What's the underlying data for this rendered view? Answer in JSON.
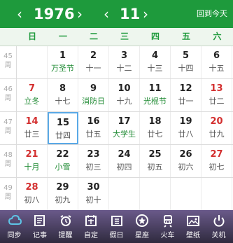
{
  "header": {
    "prev_year": "‹",
    "year": "1976",
    "next_year": "›",
    "prev_month": "‹",
    "month": "11",
    "next_month": "›",
    "today": "回到今天"
  },
  "weekdays": [
    "日",
    "一",
    "二",
    "三",
    "四",
    "五",
    "六"
  ],
  "weeks": [
    {
      "num": "45",
      "label": "周",
      "days": [
        {
          "d": "",
          "l": ""
        },
        {
          "d": "1",
          "l": "万圣节",
          "c": "grn"
        },
        {
          "d": "2",
          "l": "十一"
        },
        {
          "d": "3",
          "l": "十二"
        },
        {
          "d": "4",
          "l": "十三"
        },
        {
          "d": "5",
          "l": "十四"
        },
        {
          "d": "6",
          "l": "十五"
        }
      ]
    },
    {
      "num": "46",
      "label": "周",
      "days": [
        {
          "d": "7",
          "l": "立冬",
          "c": "red grn"
        },
        {
          "d": "8",
          "l": "十七"
        },
        {
          "d": "9",
          "l": "消防日",
          "c": "grn"
        },
        {
          "d": "10",
          "l": "十九"
        },
        {
          "d": "11",
          "l": "光棍节",
          "c": "grn"
        },
        {
          "d": "12",
          "l": "廿一"
        },
        {
          "d": "13",
          "l": "廿二",
          "c": "red"
        }
      ]
    },
    {
      "num": "47",
      "label": "周",
      "days": [
        {
          "d": "14",
          "l": "廿三",
          "c": "red"
        },
        {
          "d": "15",
          "l": "廿四",
          "c": "sel"
        },
        {
          "d": "16",
          "l": "廿五"
        },
        {
          "d": "17",
          "l": "大学生",
          "c": "grn"
        },
        {
          "d": "18",
          "l": "廿七"
        },
        {
          "d": "19",
          "l": "廿八"
        },
        {
          "d": "20",
          "l": "廿九",
          "c": "red"
        }
      ]
    },
    {
      "num": "48",
      "label": "周",
      "days": [
        {
          "d": "21",
          "l": "十月",
          "c": "red grn"
        },
        {
          "d": "22",
          "l": "小雪",
          "c": "grn"
        },
        {
          "d": "23",
          "l": "初三"
        },
        {
          "d": "24",
          "l": "初四"
        },
        {
          "d": "25",
          "l": "初五"
        },
        {
          "d": "26",
          "l": "初六"
        },
        {
          "d": "27",
          "l": "初七",
          "c": "red"
        }
      ]
    },
    {
      "num": "49",
      "label": "周",
      "days": [
        {
          "d": "28",
          "l": "初八",
          "c": "red"
        },
        {
          "d": "29",
          "l": "初九"
        },
        {
          "d": "30",
          "l": "初十"
        },
        {
          "d": "",
          "l": ""
        },
        {
          "d": "",
          "l": ""
        },
        {
          "d": "",
          "l": ""
        },
        {
          "d": "",
          "l": ""
        }
      ]
    }
  ],
  "toolbar": [
    {
      "name": "sync",
      "label": "同步",
      "icon": "cloud-icon"
    },
    {
      "name": "note",
      "label": "记事",
      "icon": "notepad-icon"
    },
    {
      "name": "reminder",
      "label": "提醒",
      "icon": "alarm-clock-icon"
    },
    {
      "name": "custom",
      "label": "自定",
      "icon": "calendar-custom-icon"
    },
    {
      "name": "holiday",
      "label": "假日",
      "icon": "holiday-calendar-icon"
    },
    {
      "name": "horoscope",
      "label": "星座",
      "icon": "star-icon"
    },
    {
      "name": "train",
      "label": "火车",
      "icon": "train-icon"
    },
    {
      "name": "wallpaper",
      "label": "壁纸",
      "icon": "picture-icon"
    },
    {
      "name": "shutdown",
      "label": "关机",
      "icon": "power-icon"
    }
  ]
}
